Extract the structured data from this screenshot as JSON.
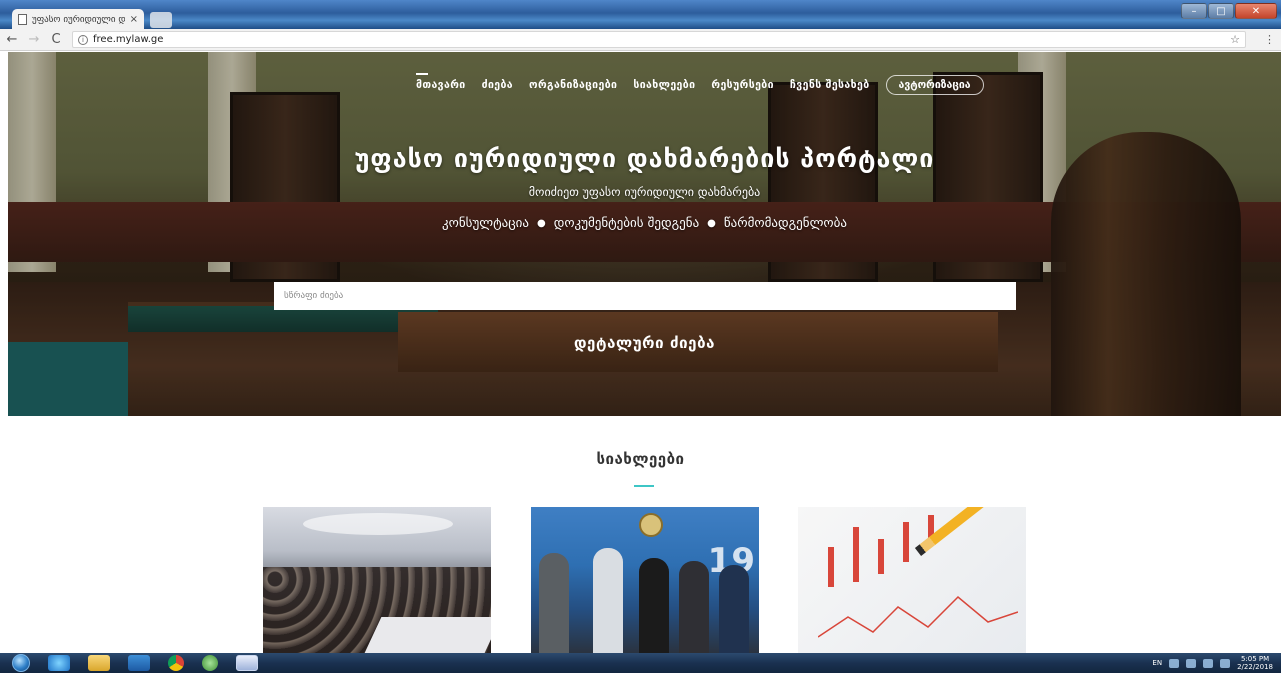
{
  "browser": {
    "tab_title": "უფასო იურიდიული დ",
    "tab_close": "×",
    "url": "free.mylaw.ge",
    "back": "←",
    "forward": "→",
    "reload": "C",
    "star": "☆",
    "menu": "⋮"
  },
  "nav": {
    "items": [
      "მთავარი",
      "ძიება",
      "ორგანიზაციები",
      "სიახლეები",
      "რესურსები",
      "ჩვენს შესახებ"
    ],
    "auth": "ავტორიზაცია"
  },
  "hero": {
    "title": "უფასო იურიდიული დახმარების პორტალი",
    "subtitle": "მოიძიეთ უფასო იურიდიული დახმარება",
    "services": [
      "კონსულტაცია",
      "დოკუმენტების შედგენა",
      "წარმომადგენლობა"
    ],
    "bullet": "●",
    "search_placeholder": "სწრაფი ძიება",
    "advanced_search": "დეტალური ძიება"
  },
  "news": {
    "heading": "სიახლეები"
  },
  "card2_number": "19",
  "taskbar": {
    "lang": "EN",
    "time": "5:05 PM",
    "date": "2/22/2018"
  },
  "colors": {
    "accent": "#3ec6c6",
    "taskbar": "#1a3150"
  }
}
